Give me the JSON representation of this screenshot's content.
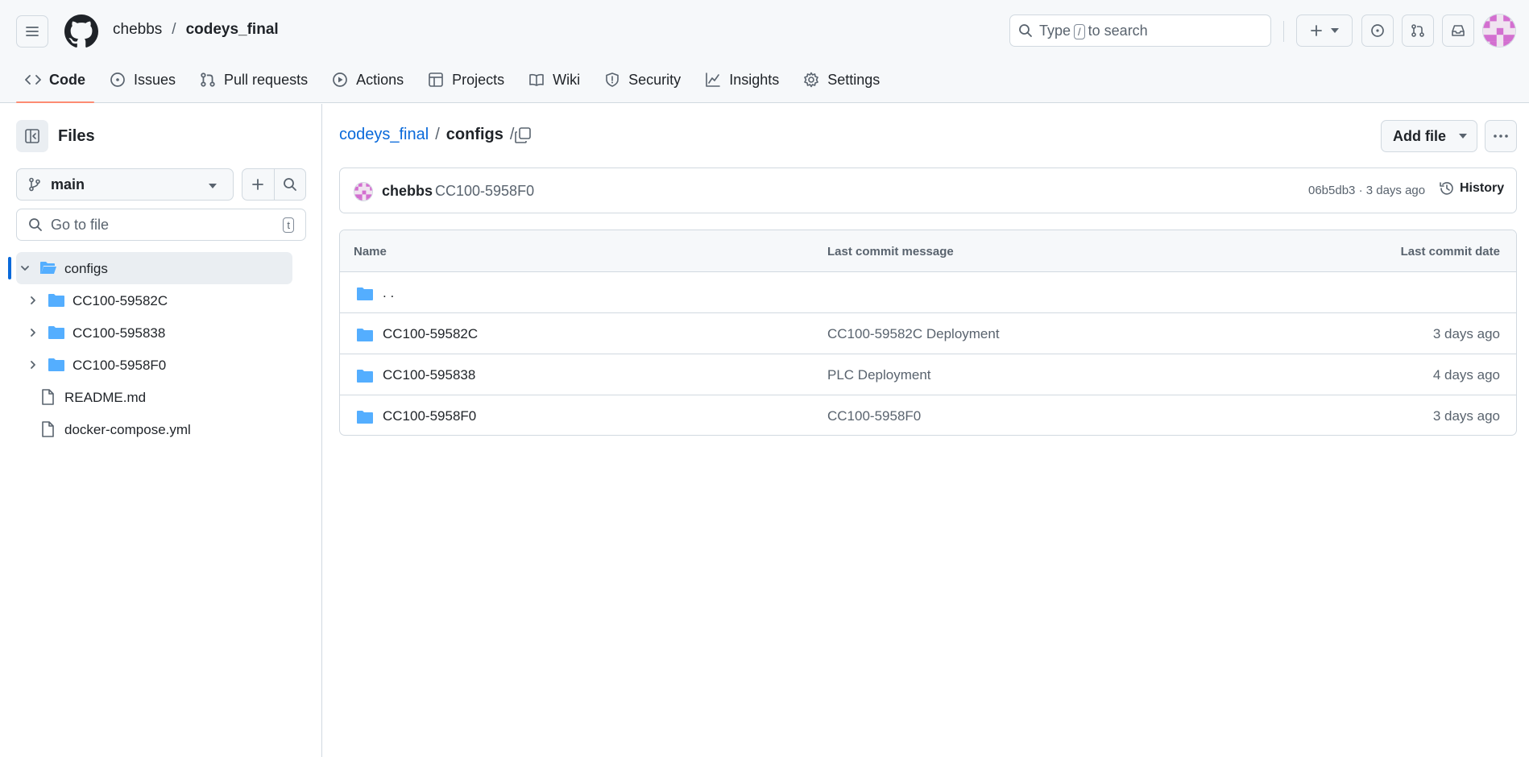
{
  "header": {
    "owner": "chebbs",
    "separator": "/",
    "repo": "codeys_final",
    "search_prefix": "Type",
    "search_key": "/",
    "search_suffix": "to search"
  },
  "tabs": [
    {
      "label": "Code",
      "icon": "code-icon",
      "active": true
    },
    {
      "label": "Issues",
      "icon": "issue-icon"
    },
    {
      "label": "Pull requests",
      "icon": "pull-request-icon"
    },
    {
      "label": "Actions",
      "icon": "play-icon"
    },
    {
      "label": "Projects",
      "icon": "table-icon"
    },
    {
      "label": "Wiki",
      "icon": "book-icon"
    },
    {
      "label": "Security",
      "icon": "shield-icon"
    },
    {
      "label": "Insights",
      "icon": "graph-icon"
    },
    {
      "label": "Settings",
      "icon": "gear-icon"
    }
  ],
  "sidebar": {
    "title": "Files",
    "branch": "main",
    "goto_placeholder": "Go to file",
    "goto_key": "t",
    "tree": [
      {
        "label": "configs",
        "type": "folder-open",
        "expanded": true,
        "selected": true
      },
      {
        "label": "CC100-59582C",
        "type": "folder"
      },
      {
        "label": "CC100-595838",
        "type": "folder"
      },
      {
        "label": "CC100-5958F0",
        "type": "folder"
      },
      {
        "label": "README.md",
        "type": "file"
      },
      {
        "label": "docker-compose.yml",
        "type": "file"
      }
    ]
  },
  "breadcrumb": {
    "root": "codeys_final",
    "sep": "/",
    "current": "configs",
    "trail": "/"
  },
  "actions": {
    "add_file": "Add file"
  },
  "latest_commit": {
    "author": "chebbs",
    "message": "CC100-5958F0",
    "meta": "06b5db3 · 3 days ago",
    "history_label": "History"
  },
  "table": {
    "headers": [
      "Name",
      "Last commit message",
      "Last commit date"
    ],
    "parent_label": ". .",
    "rows": [
      {
        "name": "CC100-59582C",
        "message": "CC100-59582C Deployment",
        "date": "3 days ago"
      },
      {
        "name": "CC100-595838",
        "message": "PLC Deployment",
        "date": "4 days ago"
      },
      {
        "name": "CC100-5958F0",
        "message": "CC100-5958F0",
        "date": "3 days ago"
      }
    ]
  },
  "colors": {
    "accent_link": "#0969da",
    "folder": "#54aeff",
    "tab_underline": "#fd8c73",
    "avatar": "#d36fd0"
  }
}
